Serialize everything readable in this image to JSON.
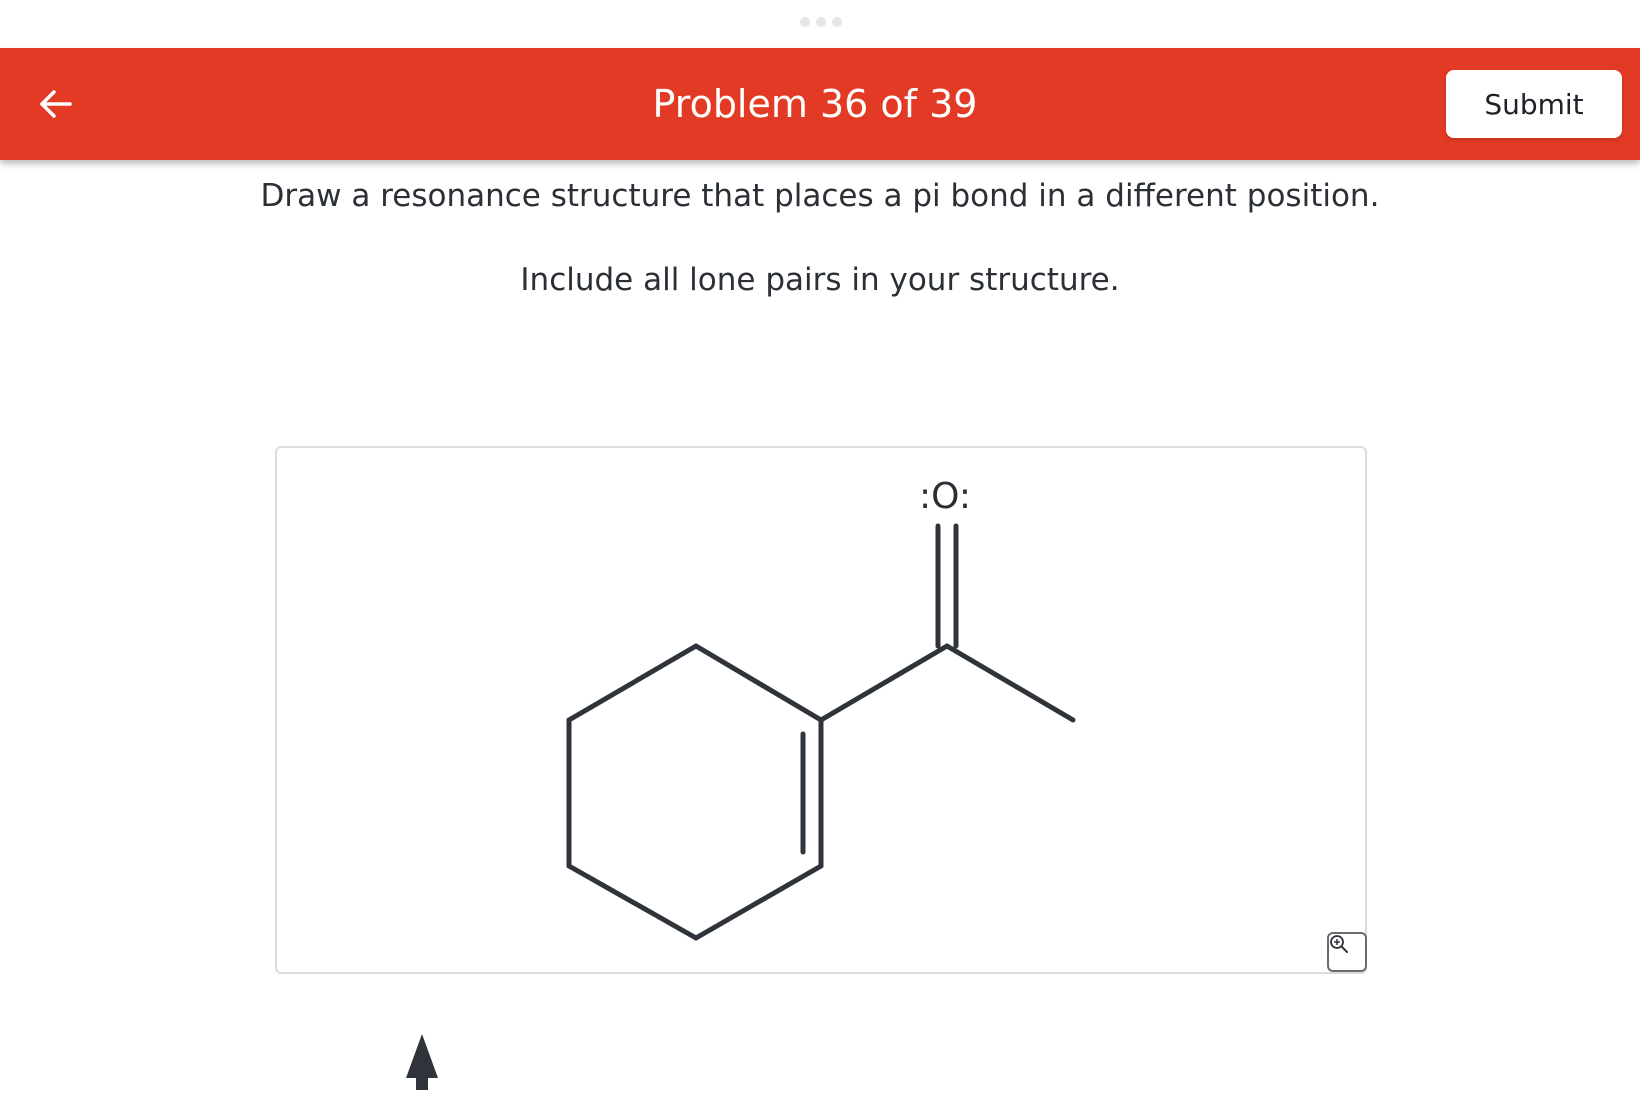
{
  "header": {
    "back_icon": "arrow-left-icon",
    "title": "Problem 36 of 39",
    "submit_label": "Submit",
    "background_color": "#e33a26"
  },
  "question": {
    "prompt": "Draw a resonance structure that places a pi bond in a different position.",
    "instruction": "Include all lone pairs in your structure."
  },
  "molecule": {
    "oxygen_label": ":O:",
    "bond_color": "#2f343b"
  },
  "canvas_controls": {
    "zoom_icon": "zoom-in-icon"
  },
  "bottom": {
    "icon": "up-arrow-icon"
  }
}
